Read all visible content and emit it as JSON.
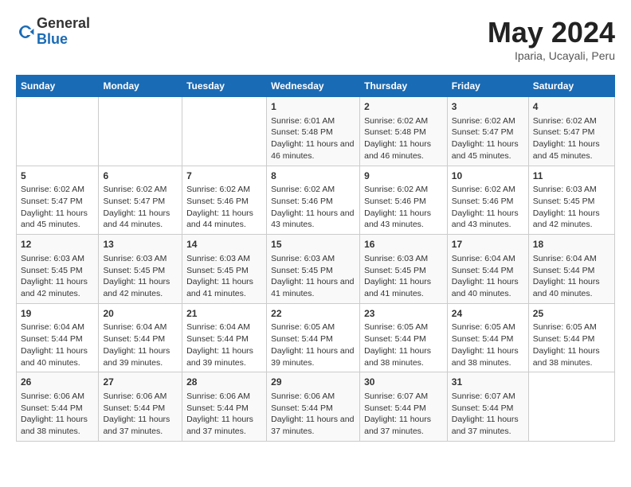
{
  "header": {
    "logo_general": "General",
    "logo_blue": "Blue",
    "month_year": "May 2024",
    "location": "Iparia, Ucayali, Peru"
  },
  "days_of_week": [
    "Sunday",
    "Monday",
    "Tuesday",
    "Wednesday",
    "Thursday",
    "Friday",
    "Saturday"
  ],
  "weeks": [
    [
      {
        "day": "",
        "sunrise": "",
        "sunset": "",
        "daylight": ""
      },
      {
        "day": "",
        "sunrise": "",
        "sunset": "",
        "daylight": ""
      },
      {
        "day": "",
        "sunrise": "",
        "sunset": "",
        "daylight": ""
      },
      {
        "day": "1",
        "sunrise": "Sunrise: 6:01 AM",
        "sunset": "Sunset: 5:48 PM",
        "daylight": "Daylight: 11 hours and 46 minutes."
      },
      {
        "day": "2",
        "sunrise": "Sunrise: 6:02 AM",
        "sunset": "Sunset: 5:48 PM",
        "daylight": "Daylight: 11 hours and 46 minutes."
      },
      {
        "day": "3",
        "sunrise": "Sunrise: 6:02 AM",
        "sunset": "Sunset: 5:47 PM",
        "daylight": "Daylight: 11 hours and 45 minutes."
      },
      {
        "day": "4",
        "sunrise": "Sunrise: 6:02 AM",
        "sunset": "Sunset: 5:47 PM",
        "daylight": "Daylight: 11 hours and 45 minutes."
      }
    ],
    [
      {
        "day": "5",
        "sunrise": "Sunrise: 6:02 AM",
        "sunset": "Sunset: 5:47 PM",
        "daylight": "Daylight: 11 hours and 45 minutes."
      },
      {
        "day": "6",
        "sunrise": "Sunrise: 6:02 AM",
        "sunset": "Sunset: 5:47 PM",
        "daylight": "Daylight: 11 hours and 44 minutes."
      },
      {
        "day": "7",
        "sunrise": "Sunrise: 6:02 AM",
        "sunset": "Sunset: 5:46 PM",
        "daylight": "Daylight: 11 hours and 44 minutes."
      },
      {
        "day": "8",
        "sunrise": "Sunrise: 6:02 AM",
        "sunset": "Sunset: 5:46 PM",
        "daylight": "Daylight: 11 hours and 43 minutes."
      },
      {
        "day": "9",
        "sunrise": "Sunrise: 6:02 AM",
        "sunset": "Sunset: 5:46 PM",
        "daylight": "Daylight: 11 hours and 43 minutes."
      },
      {
        "day": "10",
        "sunrise": "Sunrise: 6:02 AM",
        "sunset": "Sunset: 5:46 PM",
        "daylight": "Daylight: 11 hours and 43 minutes."
      },
      {
        "day": "11",
        "sunrise": "Sunrise: 6:03 AM",
        "sunset": "Sunset: 5:45 PM",
        "daylight": "Daylight: 11 hours and 42 minutes."
      }
    ],
    [
      {
        "day": "12",
        "sunrise": "Sunrise: 6:03 AM",
        "sunset": "Sunset: 5:45 PM",
        "daylight": "Daylight: 11 hours and 42 minutes."
      },
      {
        "day": "13",
        "sunrise": "Sunrise: 6:03 AM",
        "sunset": "Sunset: 5:45 PM",
        "daylight": "Daylight: 11 hours and 42 minutes."
      },
      {
        "day": "14",
        "sunrise": "Sunrise: 6:03 AM",
        "sunset": "Sunset: 5:45 PM",
        "daylight": "Daylight: 11 hours and 41 minutes."
      },
      {
        "day": "15",
        "sunrise": "Sunrise: 6:03 AM",
        "sunset": "Sunset: 5:45 PM",
        "daylight": "Daylight: 11 hours and 41 minutes."
      },
      {
        "day": "16",
        "sunrise": "Sunrise: 6:03 AM",
        "sunset": "Sunset: 5:45 PM",
        "daylight": "Daylight: 11 hours and 41 minutes."
      },
      {
        "day": "17",
        "sunrise": "Sunrise: 6:04 AM",
        "sunset": "Sunset: 5:44 PM",
        "daylight": "Daylight: 11 hours and 40 minutes."
      },
      {
        "day": "18",
        "sunrise": "Sunrise: 6:04 AM",
        "sunset": "Sunset: 5:44 PM",
        "daylight": "Daylight: 11 hours and 40 minutes."
      }
    ],
    [
      {
        "day": "19",
        "sunrise": "Sunrise: 6:04 AM",
        "sunset": "Sunset: 5:44 PM",
        "daylight": "Daylight: 11 hours and 40 minutes."
      },
      {
        "day": "20",
        "sunrise": "Sunrise: 6:04 AM",
        "sunset": "Sunset: 5:44 PM",
        "daylight": "Daylight: 11 hours and 39 minutes."
      },
      {
        "day": "21",
        "sunrise": "Sunrise: 6:04 AM",
        "sunset": "Sunset: 5:44 PM",
        "daylight": "Daylight: 11 hours and 39 minutes."
      },
      {
        "day": "22",
        "sunrise": "Sunrise: 6:05 AM",
        "sunset": "Sunset: 5:44 PM",
        "daylight": "Daylight: 11 hours and 39 minutes."
      },
      {
        "day": "23",
        "sunrise": "Sunrise: 6:05 AM",
        "sunset": "Sunset: 5:44 PM",
        "daylight": "Daylight: 11 hours and 38 minutes."
      },
      {
        "day": "24",
        "sunrise": "Sunrise: 6:05 AM",
        "sunset": "Sunset: 5:44 PM",
        "daylight": "Daylight: 11 hours and 38 minutes."
      },
      {
        "day": "25",
        "sunrise": "Sunrise: 6:05 AM",
        "sunset": "Sunset: 5:44 PM",
        "daylight": "Daylight: 11 hours and 38 minutes."
      }
    ],
    [
      {
        "day": "26",
        "sunrise": "Sunrise: 6:06 AM",
        "sunset": "Sunset: 5:44 PM",
        "daylight": "Daylight: 11 hours and 38 minutes."
      },
      {
        "day": "27",
        "sunrise": "Sunrise: 6:06 AM",
        "sunset": "Sunset: 5:44 PM",
        "daylight": "Daylight: 11 hours and 37 minutes."
      },
      {
        "day": "28",
        "sunrise": "Sunrise: 6:06 AM",
        "sunset": "Sunset: 5:44 PM",
        "daylight": "Daylight: 11 hours and 37 minutes."
      },
      {
        "day": "29",
        "sunrise": "Sunrise: 6:06 AM",
        "sunset": "Sunset: 5:44 PM",
        "daylight": "Daylight: 11 hours and 37 minutes."
      },
      {
        "day": "30",
        "sunrise": "Sunrise: 6:07 AM",
        "sunset": "Sunset: 5:44 PM",
        "daylight": "Daylight: 11 hours and 37 minutes."
      },
      {
        "day": "31",
        "sunrise": "Sunrise: 6:07 AM",
        "sunset": "Sunset: 5:44 PM",
        "daylight": "Daylight: 11 hours and 37 minutes."
      },
      {
        "day": "",
        "sunrise": "",
        "sunset": "",
        "daylight": ""
      }
    ]
  ]
}
